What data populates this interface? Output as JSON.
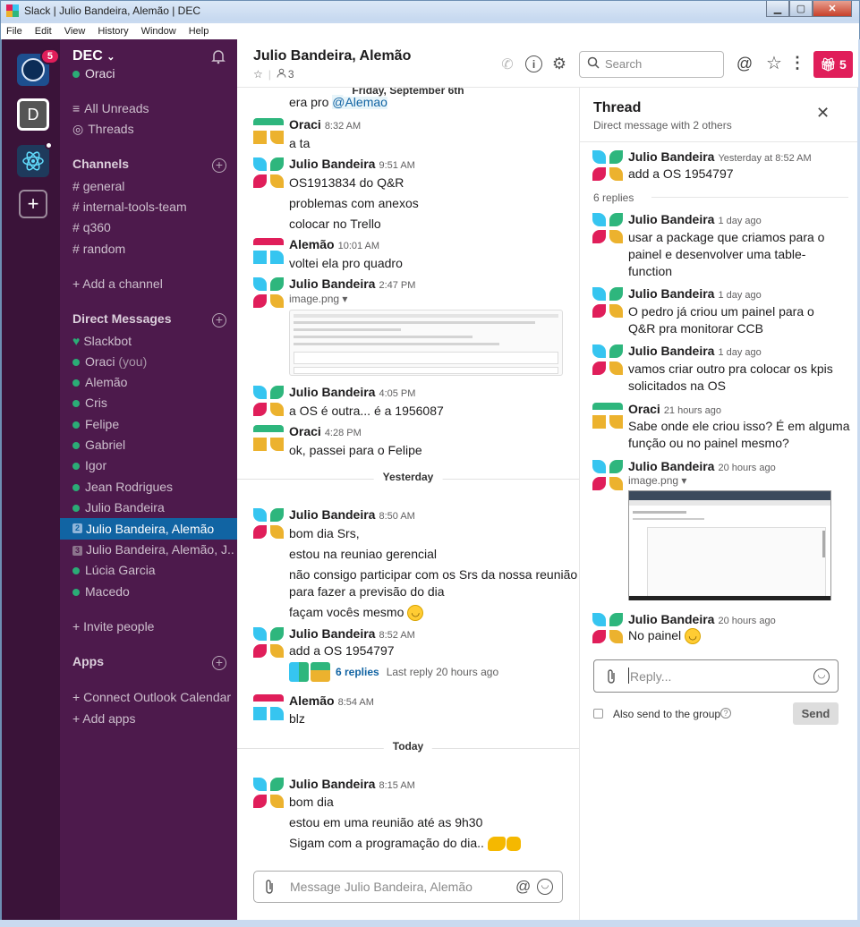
{
  "window": {
    "title": "Slack | Julio Bandeira, Alemão | DEC"
  },
  "menu": [
    "File",
    "Edit",
    "View",
    "History",
    "Window",
    "Help"
  ],
  "teams": [
    {
      "label": "",
      "badge": "5"
    },
    {
      "label": "D"
    },
    {
      "label": ""
    },
    {
      "label": "+"
    }
  ],
  "workspace": {
    "name": "DEC",
    "user": "Oraci"
  },
  "sidebar": {
    "top": [
      "All Unreads",
      "Threads"
    ],
    "channels_header": "Channels",
    "channels": [
      "general",
      "internal-tools-team",
      "q360",
      "random"
    ],
    "add_channel": "Add a channel",
    "dm_header": "Direct Messages",
    "dms": [
      "Slackbot",
      "Oraci",
      "Alemão",
      "Cris",
      "Felipe",
      "Gabriel",
      "Igor",
      "Jean Rodrigues",
      "Julio Bandeira",
      "Julio Bandeira, Alemão",
      "Julio Bandeira, Alemão, J...",
      "Lúcia Garcia",
      "Macedo"
    ],
    "you_label": "(you)",
    "dm_badges": {
      "julio_alemao": "2",
      "julio_alemao_j": "3"
    },
    "invite": "Invite people",
    "apps_header": "Apps",
    "apps": [
      "Connect Outlook Calendar",
      "Add apps"
    ]
  },
  "channel": {
    "title": "Julio Bandeira, Alemão",
    "members": "3",
    "search_placeholder": "Search",
    "gift_count": "5"
  },
  "days": {
    "d1": "Friday, September 6th",
    "d2": "Yesterday",
    "d3": "Today"
  },
  "messages": {
    "m0": "era pro",
    "m0_mention": "@Alemao",
    "m1_name": "Oraci",
    "m1_time": "8:32 AM",
    "m1_text": "a ta",
    "m2_name": "Julio Bandeira",
    "m2_time": "9:51 AM",
    "m2_t1": "OS1913834 do Q&R",
    "m2_t2": "problemas com anexos",
    "m2_t3": "colocar no Trello",
    "m3_name": "Alemão",
    "m3_time": "10:01 AM",
    "m3_text": "voltei ela pro quadro",
    "m4_name": "Julio Bandeira",
    "m4_time": "2:47 PM",
    "m4_file": "image.png",
    "m5_name": "Julio Bandeira",
    "m5_time": "4:05 PM",
    "m5_text": "a OS é outra... é a 1956087",
    "m6_name": "Oraci",
    "m6_time": "4:28 PM",
    "m6_text": "ok, passei para o Felipe",
    "m7_name": "Julio Bandeira",
    "m7_time": "8:50 AM",
    "m7_t1": "bom dia Srs,",
    "m7_t2": "estou na reuniao gerencial",
    "m7_t3": "não consigo participar com os Srs da nossa reunião",
    "m7_t4": "para fazer a previsão do dia",
    "m7_t5": "façam vocês mesmo",
    "m8_name": "Julio Bandeira",
    "m8_time": "8:52 AM",
    "m8_text": "add a OS 1954797",
    "m8_replies": "6 replies",
    "m8_last": "Last reply 20 hours ago",
    "m9_name": "Alemão",
    "m9_time": "8:54 AM",
    "m9_text": "blz",
    "m10_name": "Julio Bandeira",
    "m10_time": "8:15 AM",
    "m10_t1": "bom dia",
    "m10_t2": "estou em uma reunião até as 9h30",
    "m10_t3": "Sigam com a programação do dia.."
  },
  "composer": {
    "placeholder": "Message Julio Bandeira, Alemão"
  },
  "thread": {
    "title": "Thread",
    "subtitle": "Direct message with 2 others",
    "parent_name": "Julio Bandeira",
    "parent_time": "Yesterday at 8:52 AM",
    "parent_text": "add a OS 1954797",
    "replies_count": "6 replies",
    "r1_name": "Julio Bandeira",
    "r1_time": "1 day ago",
    "r1_t1": "usar a package que criamos para o",
    "r1_t2": "painel e desenvolver uma table-",
    "r1_t3": "function",
    "r2_name": "Julio Bandeira",
    "r2_time": "1 day ago",
    "r2_t1": "O pedro já criou um painel para o",
    "r2_t2": "Q&R pra monitorar CCB",
    "r3_name": "Julio Bandeira",
    "r3_time": "1 day ago",
    "r3_t1": "vamos criar outro pra colocar os kpis",
    "r3_t2": "solicitados na OS",
    "r4_name": "Oraci",
    "r4_time": "21 hours ago",
    "r4_t1": "Sabe onde ele criou isso? É em alguma",
    "r4_t2": "função ou no painel mesmo?",
    "r5_name": "Julio Bandeira",
    "r5_time": "20 hours ago",
    "r5_file": "image.png",
    "r6_name": "Julio Bandeira",
    "r6_time": "20 hours ago",
    "r6_text": "No painel",
    "reply_placeholder": "Reply...",
    "also_send": "Also send to the group",
    "send": "Send"
  },
  "colors": {
    "aubergine": "#4d1a4c",
    "teams_bg": "#3a1339",
    "active": "#1164a3",
    "presence": "#2bac76",
    "link": "#1264a3",
    "gift": "#e01e5a"
  }
}
